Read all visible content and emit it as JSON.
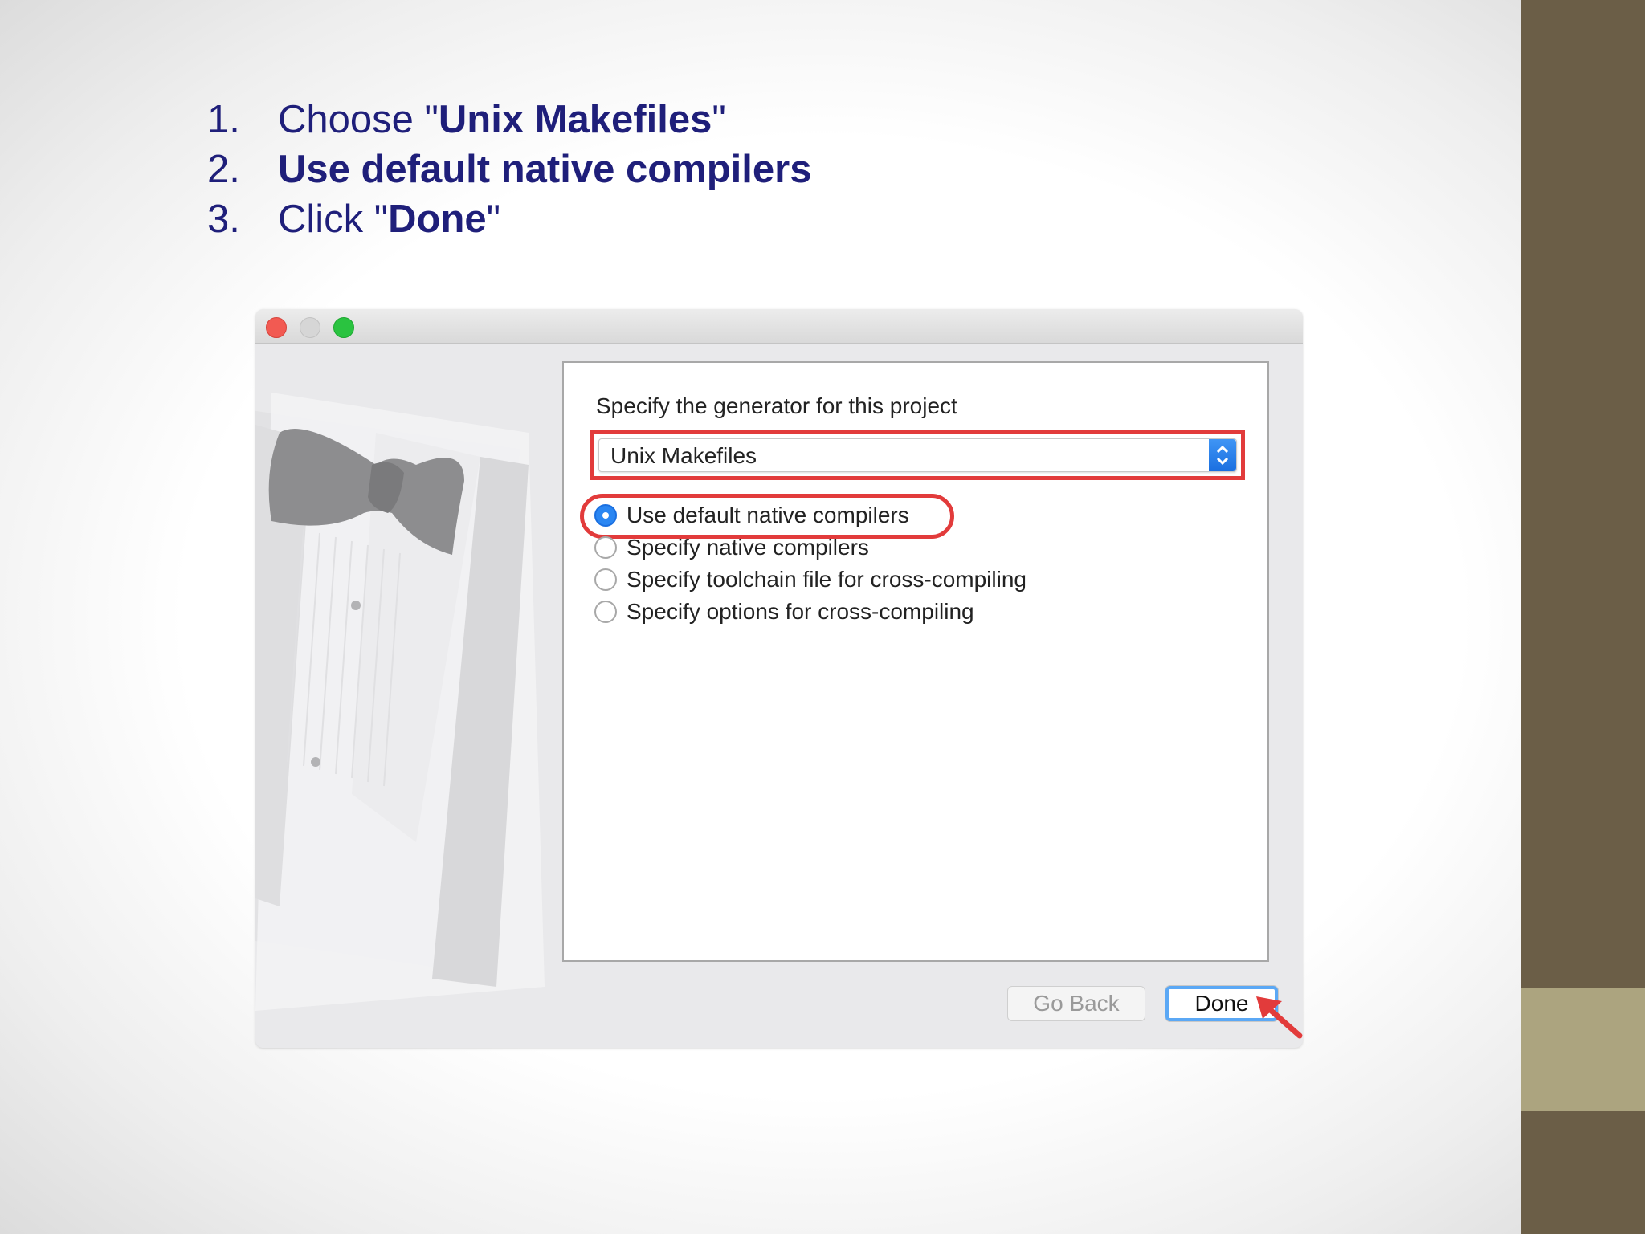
{
  "instructions": [
    {
      "num": "1.",
      "pre": "Choose \"",
      "bold": "Unix Makefiles",
      "post": "\""
    },
    {
      "num": "2.",
      "pre": "",
      "bold": "Use default native compilers",
      "post": ""
    },
    {
      "num": "3.",
      "pre": "Click \"",
      "bold": "Done",
      "post": "\""
    }
  ],
  "window": {
    "prompt": "Specify the generator for this project",
    "generator": {
      "selected": "Unix Makefiles"
    },
    "radios": [
      {
        "label": "Use default native compilers",
        "selected": true
      },
      {
        "label": "Specify native compilers",
        "selected": false
      },
      {
        "label": "Specify toolchain file for cross-compiling",
        "selected": false
      },
      {
        "label": "Specify options for cross-compiling",
        "selected": false
      }
    ],
    "buttons": {
      "back": "Go Back",
      "done": "Done"
    }
  },
  "colors": {
    "instruction_text": "#1f1f7a",
    "highlight": "#e23b3b",
    "side_bar": "#6b5e47",
    "side_accent": "#aca47f",
    "accent_blue": "#2a86f2"
  },
  "icons": [
    "close-icon",
    "minimize-icon",
    "maximize-icon",
    "stepper-arrows-icon",
    "pointer-arrow-icon"
  ]
}
